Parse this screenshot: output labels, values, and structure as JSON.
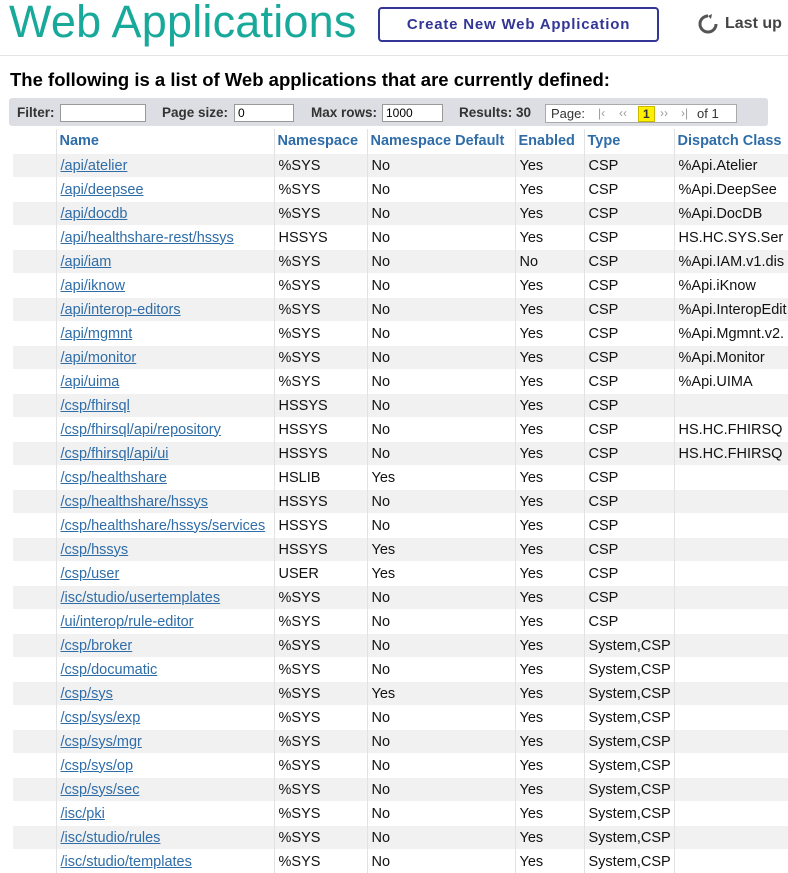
{
  "header": {
    "title": "Web Applications",
    "create_button": "Create New Web Application",
    "last_update": "Last up"
  },
  "subtitle": "The following is a list of Web applications that are currently defined:",
  "filter": {
    "filter_label": "Filter:",
    "filter_value": "",
    "page_size_label": "Page size:",
    "page_size_value": "0",
    "max_rows_label": "Max rows:",
    "max_rows_value": "1000",
    "results_label": "Results: 30",
    "page_label": "Page:",
    "first": "|‹",
    "prev": "‹‹",
    "current_page": "1",
    "next": "››",
    "last": "›|",
    "of_pages": "of 1"
  },
  "columns": [
    "Name",
    "Namespace",
    "Namespace Default",
    "Enabled",
    "Type",
    "Dispatch Class"
  ],
  "rows": [
    [
      "/api/atelier",
      "%SYS",
      "No",
      "Yes",
      "CSP",
      "%Api.Atelier"
    ],
    [
      "/api/deepsee",
      "%SYS",
      "No",
      "Yes",
      "CSP",
      "%Api.DeepSee"
    ],
    [
      "/api/docdb",
      "%SYS",
      "No",
      "Yes",
      "CSP",
      "%Api.DocDB"
    ],
    [
      "/api/healthshare-rest/hssys",
      "HSSYS",
      "No",
      "Yes",
      "CSP",
      "HS.HC.SYS.Ser"
    ],
    [
      "/api/iam",
      "%SYS",
      "No",
      "No",
      "CSP",
      "%Api.IAM.v1.dis"
    ],
    [
      "/api/iknow",
      "%SYS",
      "No",
      "Yes",
      "CSP",
      "%Api.iKnow"
    ],
    [
      "/api/interop-editors",
      "%SYS",
      "No",
      "Yes",
      "CSP",
      "%Api.InteropEdit"
    ],
    [
      "/api/mgmnt",
      "%SYS",
      "No",
      "Yes",
      "CSP",
      "%Api.Mgmnt.v2."
    ],
    [
      "/api/monitor",
      "%SYS",
      "No",
      "Yes",
      "CSP",
      "%Api.Monitor"
    ],
    [
      "/api/uima",
      "%SYS",
      "No",
      "Yes",
      "CSP",
      "%Api.UIMA"
    ],
    [
      "/csp/fhirsql",
      "HSSYS",
      "No",
      "Yes",
      "CSP",
      ""
    ],
    [
      "/csp/fhirsql/api/repository",
      "HSSYS",
      "No",
      "Yes",
      "CSP",
      "HS.HC.FHIRSQ"
    ],
    [
      "/csp/fhirsql/api/ui",
      "HSSYS",
      "No",
      "Yes",
      "CSP",
      "HS.HC.FHIRSQ"
    ],
    [
      "/csp/healthshare",
      "HSLIB",
      "Yes",
      "Yes",
      "CSP",
      ""
    ],
    [
      "/csp/healthshare/hssys",
      "HSSYS",
      "No",
      "Yes",
      "CSP",
      ""
    ],
    [
      "/csp/healthshare/hssys/services",
      "HSSYS",
      "No",
      "Yes",
      "CSP",
      ""
    ],
    [
      "/csp/hssys",
      "HSSYS",
      "Yes",
      "Yes",
      "CSP",
      ""
    ],
    [
      "/csp/user",
      "USER",
      "Yes",
      "Yes",
      "CSP",
      ""
    ],
    [
      "/isc/studio/usertemplates",
      "%SYS",
      "No",
      "Yes",
      "CSP",
      ""
    ],
    [
      "/ui/interop/rule-editor",
      "%SYS",
      "No",
      "Yes",
      "CSP",
      ""
    ],
    [
      "/csp/broker",
      "%SYS",
      "No",
      "Yes",
      "System,CSP",
      ""
    ],
    [
      "/csp/documatic",
      "%SYS",
      "No",
      "Yes",
      "System,CSP",
      ""
    ],
    [
      "/csp/sys",
      "%SYS",
      "Yes",
      "Yes",
      "System,CSP",
      ""
    ],
    [
      "/csp/sys/exp",
      "%SYS",
      "No",
      "Yes",
      "System,CSP",
      ""
    ],
    [
      "/csp/sys/mgr",
      "%SYS",
      "No",
      "Yes",
      "System,CSP",
      ""
    ],
    [
      "/csp/sys/op",
      "%SYS",
      "No",
      "Yes",
      "System,CSP",
      ""
    ],
    [
      "/csp/sys/sec",
      "%SYS",
      "No",
      "Yes",
      "System,CSP",
      ""
    ],
    [
      "/isc/pki",
      "%SYS",
      "No",
      "Yes",
      "System,CSP",
      ""
    ],
    [
      "/isc/studio/rules",
      "%SYS",
      "No",
      "Yes",
      "System,CSP",
      ""
    ],
    [
      "/isc/studio/templates",
      "%SYS",
      "No",
      "Yes",
      "System,CSP",
      ""
    ]
  ],
  "colors": {
    "title": "#18a99b",
    "button_border": "#333695",
    "link": "#2f6da8",
    "row_alt": "#f1f1f1",
    "filter_bar": "#dddee3",
    "current_page": "#ffef00"
  }
}
